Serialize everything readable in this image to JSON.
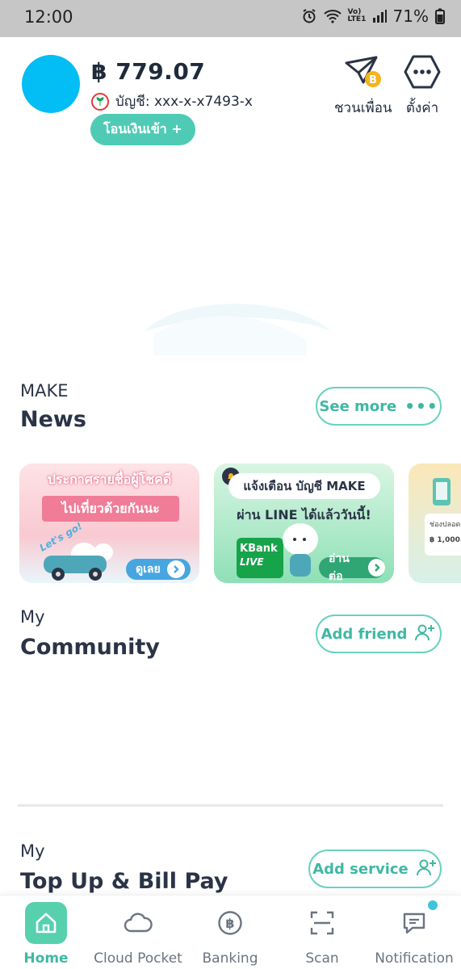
{
  "status_bar": {
    "time": "12:00",
    "battery": "71%",
    "network": "Vo) LTE1"
  },
  "header": {
    "balance": "฿ 779.07",
    "account": "บัญชี: xxx-x-x7493-x",
    "topup_label": "โอนเงินเข้า +",
    "invite_label": "ชวนเพื่อน",
    "settings_label": "ตั้งค่า"
  },
  "news": {
    "subtitle": "MAKE",
    "title": "News",
    "see_more_label": "See more",
    "banners": [
      {
        "title": "ประกาศรายชื่อผู้โชคดี",
        "ribbon": "ไปเที่ยวด้วยกันนะ",
        "tag": "Let's go!",
        "cta": "ดูเลย"
      },
      {
        "title": "แจ้งเตือน บัญชี MAKE",
        "subtitle": "ผ่าน LINE ได้แล้ววันนี้!",
        "card_line1": "KBank",
        "card_line2": "LIVE",
        "cta": "อ่านต่อ"
      },
      {
        "card_label": "ช่องปลอด",
        "card_amount": "฿ 1,000.00"
      }
    ]
  },
  "community": {
    "subtitle": "My",
    "title": "Community",
    "add_friend_label": "Add friend"
  },
  "services": {
    "subtitle": "My",
    "title": "Top Up & Bill Pay",
    "add_service_label": "Add service"
  },
  "bottom_nav": [
    {
      "label": "Home",
      "icon": "home-icon",
      "active": true
    },
    {
      "label": "Cloud Pocket",
      "icon": "cloud-icon",
      "active": false
    },
    {
      "label": "Banking",
      "icon": "baht-coin-icon",
      "active": false
    },
    {
      "label": "Scan",
      "icon": "scan-icon",
      "active": false
    },
    {
      "label": "Notification",
      "icon": "chat-icon",
      "active": false
    }
  ],
  "colors": {
    "accent": "#4fcbb5",
    "avatar": "#03bdf5",
    "text": "#2b3446",
    "notification_dot": "#3ec6d6"
  }
}
